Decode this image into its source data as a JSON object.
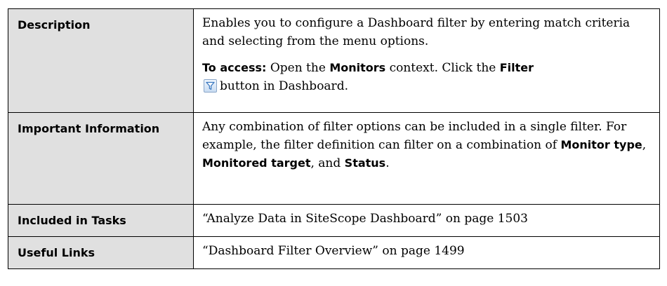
{
  "rows": {
    "description": {
      "label": "Description",
      "text": "Enables you to configure a Dashboard filter by entering match criteria and selecting from the menu options.",
      "access_label": "To access:",
      "access_part1": "Open the",
      "monitors": "Monitors",
      "access_part2": "context. Click the",
      "filter": "Filter",
      "access_part3": "button in Dashboard."
    },
    "important": {
      "label": "Important Information",
      "text_part1": "Any combination of filter options can be included in a single filter. For example, the filter definition can filter on a combination of",
      "monitor_type": "Monitor type",
      "comma1": ",",
      "monitored_target": "Monitored target",
      "comma2": ",",
      "and": "and",
      "status": "Status",
      "period": "."
    },
    "tasks": {
      "label": "Included in Tasks",
      "link": "“Analyze Data in SiteScope Dashboard” on page 1503"
    },
    "links": {
      "label": "Useful Links",
      "link": "“Dashboard Filter Overview” on page 1499"
    }
  },
  "icons": {
    "filter_button": "filter-icon",
    "accent": "#3a78c0"
  }
}
